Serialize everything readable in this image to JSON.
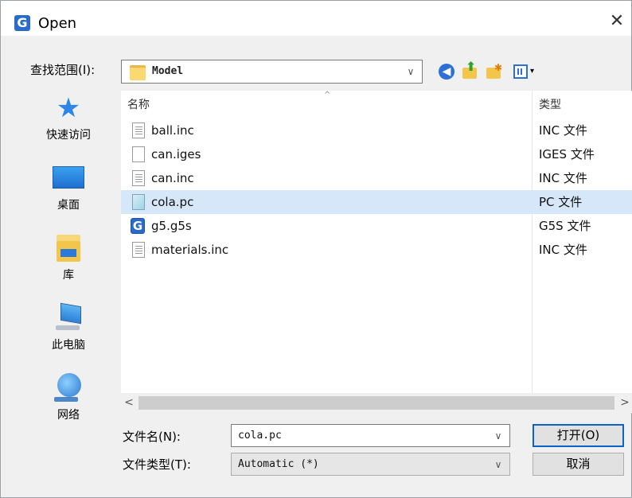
{
  "window": {
    "title": "Open",
    "close_glyph": "✕",
    "app_icon_letter": "G"
  },
  "lookin": {
    "label": "查找范围(I):",
    "value": "Model",
    "dropdown_glyph": "∨"
  },
  "toolbar": {
    "back_glyph": "◀",
    "up_glyph": "⬆",
    "new_folder_glyph": "✱",
    "view_menu_glyph": "▾"
  },
  "places": [
    {
      "label": "快速访问",
      "icon": "star-icon"
    },
    {
      "label": "桌面",
      "icon": "desktop-icon"
    },
    {
      "label": "库",
      "icon": "library-icon"
    },
    {
      "label": "此电脑",
      "icon": "computer-icon"
    },
    {
      "label": "网络",
      "icon": "network-icon"
    }
  ],
  "filelist": {
    "columns": {
      "name": "名称",
      "type": "类型"
    },
    "sort_glyph": "^",
    "files": [
      {
        "name": "ball.inc",
        "type": "INC 文件",
        "icon": "text-file-icon",
        "selected": false
      },
      {
        "name": "can.iges",
        "type": "IGES 文件",
        "icon": "blank-file-icon",
        "selected": false
      },
      {
        "name": "can.inc",
        "type": "INC 文件",
        "icon": "text-file-icon",
        "selected": false
      },
      {
        "name": "cola.pc",
        "type": "PC 文件",
        "icon": "pc-file-icon",
        "selected": true
      },
      {
        "name": "g5.g5s",
        "type": "G5S 文件",
        "icon": "g5s-file-icon",
        "selected": false
      },
      {
        "name": "materials.inc",
        "type": "INC 文件",
        "icon": "text-file-icon",
        "selected": false
      }
    ]
  },
  "hscroll": {
    "left_glyph": "<",
    "right_glyph": ">"
  },
  "filename": {
    "label": "文件名(N):",
    "value": "cola.pc",
    "dropdown_glyph": "∨"
  },
  "filetype": {
    "label": "文件类型(T):",
    "value": "Automatic (*)",
    "dropdown_glyph": "∨"
  },
  "buttons": {
    "open": "打开(O)",
    "cancel": "取消"
  }
}
